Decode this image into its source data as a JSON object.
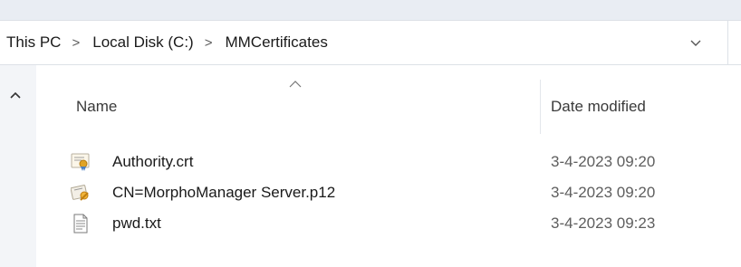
{
  "breadcrumb": {
    "items": [
      "This PC",
      "Local Disk (C:)",
      "MMCertificates"
    ]
  },
  "columns": {
    "name": "Name",
    "date_modified": "Date modified"
  },
  "files": [
    {
      "name": "Authority.crt",
      "date": "3-4-2023 09:20",
      "icon": "certificate-icon"
    },
    {
      "name": "CN=MorphoManager Server.p12",
      "date": "3-4-2023 09:20",
      "icon": "personal-certificate-icon"
    },
    {
      "name": "pwd.txt",
      "date": "3-4-2023 09:23",
      "icon": "text-file-icon"
    }
  ],
  "colors": {
    "background": "#eff2f6",
    "panel": "#ffffff",
    "accent_gold": "#e0a325",
    "accent_blue": "#4a7fc1"
  }
}
